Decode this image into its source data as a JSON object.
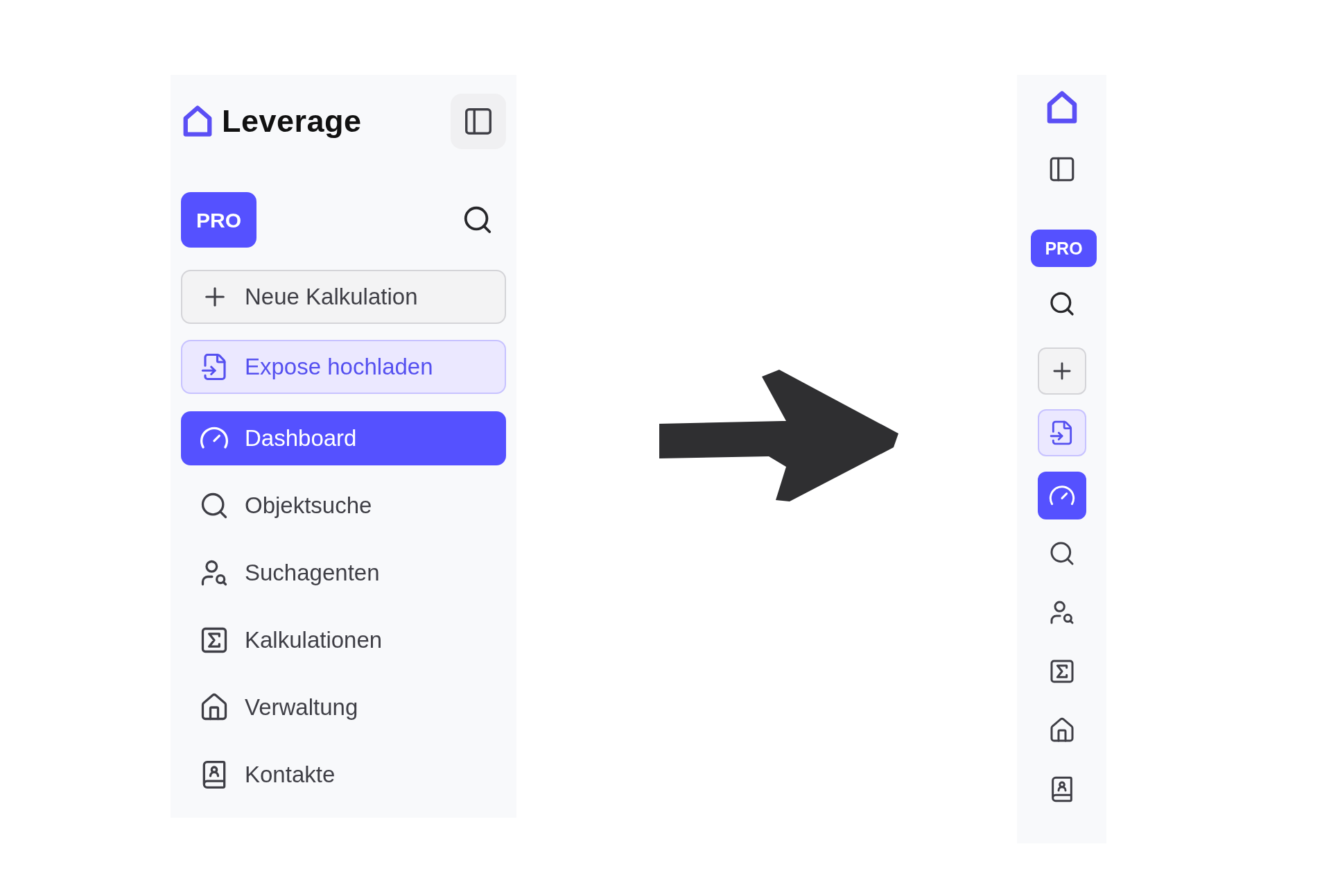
{
  "expanded_sidebar": {
    "brand": "Leverage",
    "pro_badge": "PRO",
    "actions": [
      {
        "kind": "new",
        "label": "Neue Kalkulation"
      },
      {
        "kind": "upload",
        "label": "Expose hochladen"
      }
    ],
    "nav": [
      {
        "kind": "gauge",
        "label": "Dashboard",
        "selected": true
      },
      {
        "kind": "search",
        "label": "Objektsuche",
        "selected": false
      },
      {
        "kind": "user-search",
        "label": "Suchagenten",
        "selected": false
      },
      {
        "kind": "sigma",
        "label": "Kalkulationen",
        "selected": false
      },
      {
        "kind": "house",
        "label": "Verwaltung",
        "selected": false
      },
      {
        "kind": "contacts",
        "label": "Kontakte",
        "selected": false
      }
    ]
  },
  "collapsed_sidebar": {
    "pro_badge": "PRO",
    "actions": [
      {
        "kind": "new"
      },
      {
        "kind": "upload"
      }
    ],
    "nav": [
      {
        "kind": "gauge",
        "selected": true
      },
      {
        "kind": "search",
        "selected": false
      },
      {
        "kind": "user-search",
        "selected": false
      },
      {
        "kind": "sigma",
        "selected": false
      },
      {
        "kind": "house",
        "selected": false
      },
      {
        "kind": "contacts",
        "selected": false
      }
    ]
  }
}
